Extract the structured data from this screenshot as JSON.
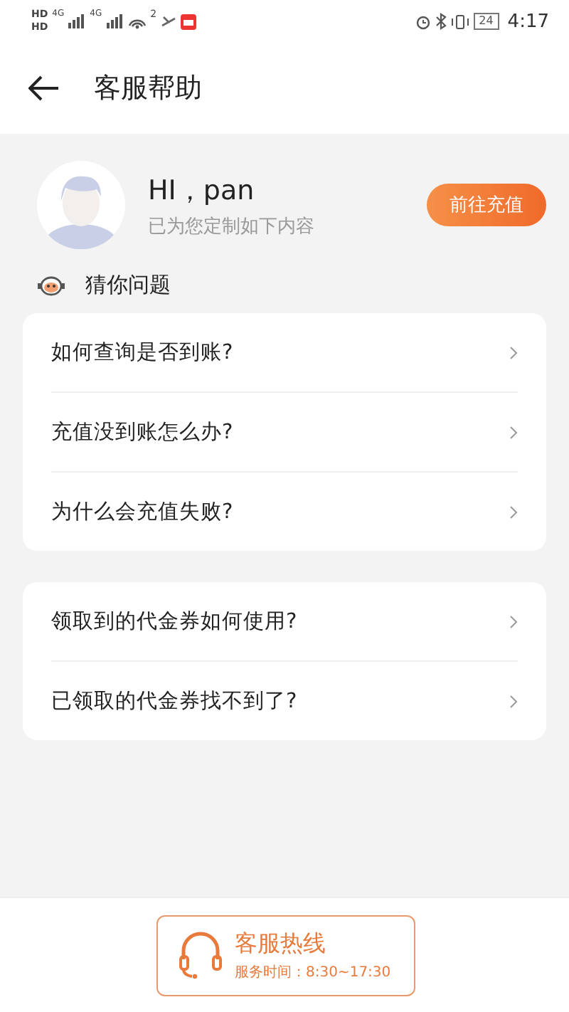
{
  "status_bar": {
    "network_labels": [
      "4G",
      "4G"
    ],
    "hd_labels": [
      "HD",
      "HD"
    ],
    "wifi_badge": "2",
    "battery": "24",
    "time": "4:17"
  },
  "header": {
    "title": "客服帮助"
  },
  "profile": {
    "greeting": "HI，pan",
    "subtitle": "已为您定制如下内容",
    "button": "前往充值"
  },
  "section": {
    "title": "猜你问题"
  },
  "groups": [
    {
      "items": [
        "如何查询是否到账?",
        "充值没到账怎么办?",
        "为什么会充值失败?"
      ]
    },
    {
      "items": [
        "领取到的代金券如何使用?",
        "已领取的代金券找不到了?"
      ]
    }
  ],
  "hotline": {
    "title": "客服热线",
    "hours": "服务时间：8:30~17:30"
  }
}
